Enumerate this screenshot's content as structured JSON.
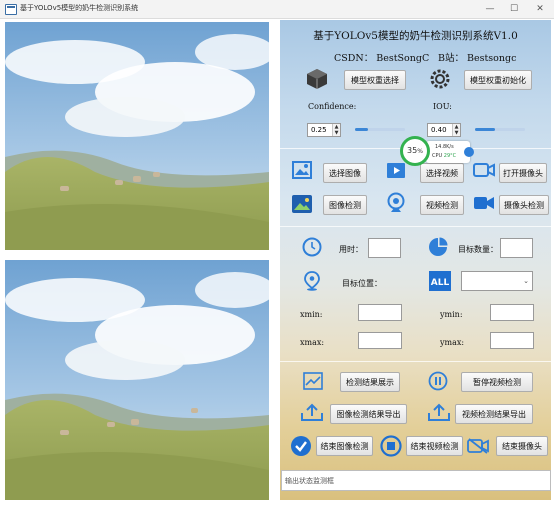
{
  "window": {
    "title": "基于YOLOv5模型的奶牛检测识别系统",
    "minimize": "—",
    "maximize": "☐",
    "close": "✕"
  },
  "app": {
    "title": "基于YOLOv5模型的奶牛检测识别系统V1.0",
    "csdn": "CSDN：  BestSongC",
    "bilibili": "B站：  Bestsongc"
  },
  "model": {
    "select_label": "模型权重选择",
    "init_label": "模型权重初始化"
  },
  "params": {
    "confidence_label": "Confidence:",
    "confidence_value": "0.25",
    "confidence_fraction": 0.25,
    "iou_label": "IOU:",
    "iou_value": "0.40",
    "iou_fraction": 0.4
  },
  "sources": {
    "select_image": "选择图像",
    "select_video": "选择视频",
    "open_camera": "打开摄像头",
    "image_detect": "图像检测",
    "video_detect": "视频检测",
    "camera_detect": "摄像头检测"
  },
  "results": {
    "time_label": "用时：",
    "count_label": "目标数量：",
    "position_label": "目标位置：",
    "xmin_label": "xmin:",
    "ymin_label": "ymin:",
    "xmax_label": "xmax:",
    "ymax_label": "ymax:"
  },
  "actions": {
    "show_results": "检测结果展示",
    "pause_video": "暂停视频检测",
    "export_image": "图像检测结果导出",
    "export_video": "视频检测结果导出",
    "end_image": "结束图像检测",
    "end_video": "结束视频检测",
    "end_camera": "结束摄像头"
  },
  "status": {
    "placeholder": "输出状态监测框"
  },
  "monitor": {
    "percent_number": "35",
    "percent_unit": "%",
    "net_speed": "14.8K/s",
    "cpu_label": "CPU",
    "cpu_value": "29°C"
  },
  "colors": {
    "accent_blue": "#2f7fd8",
    "ring_green": "#33b24f",
    "button_border": "#adadad"
  },
  "icons": {
    "cube": "cube-icon",
    "gear": "gear-icon",
    "image": "image-icon",
    "video": "video-play-icon",
    "camera": "video-camera-icon",
    "image_detect": "image-detect-icon",
    "webcam": "webcam-icon",
    "camera_detect": "camera-detect-icon",
    "clock": "clock-icon",
    "pie": "pie-chart-icon",
    "location": "location-pin-icon",
    "all": "all-icon",
    "chart": "line-chart-icon",
    "pause": "pause-icon",
    "upload": "upload-icon",
    "check": "check-circle-icon",
    "stop": "stop-circle-icon",
    "camera_off": "camera-off-icon"
  }
}
